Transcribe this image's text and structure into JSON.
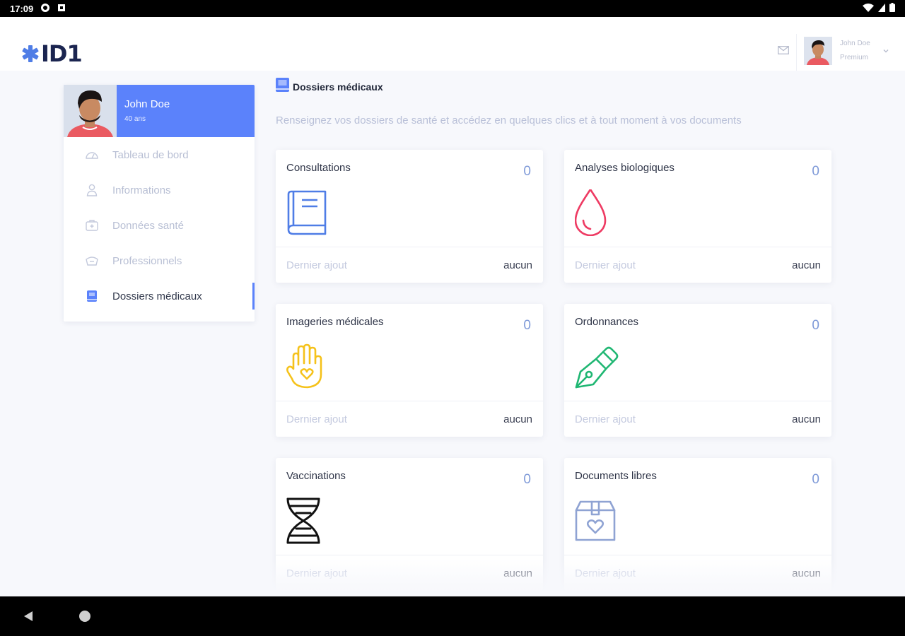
{
  "status_bar": {
    "time": "17:09"
  },
  "header": {
    "logo_text": "ID1",
    "user": {
      "name": "John Doe",
      "plan": "Premium"
    }
  },
  "profile": {
    "name": "John Doe",
    "age": "40 ans"
  },
  "sidebar": {
    "items": [
      {
        "label": "Tableau de bord",
        "icon": "dashboard-icon",
        "active": false
      },
      {
        "label": "Informations",
        "icon": "user-icon",
        "active": false
      },
      {
        "label": "Données santé",
        "icon": "health-icon",
        "active": false
      },
      {
        "label": "Professionnels",
        "icon": "professionals-icon",
        "active": false
      },
      {
        "label": "Dossiers médicaux",
        "icon": "folder-icon",
        "active": true
      }
    ]
  },
  "main": {
    "title": "Dossiers médicaux",
    "description": "Renseignez vos dossiers de santé et accédez en quelques clics et à tout moment à vos documents",
    "cards": [
      {
        "title": "Consultations",
        "count": "0",
        "icon": "book-icon",
        "color": "#4f7de6",
        "last_label": "Dernier ajout",
        "last_value": "aucun"
      },
      {
        "title": "Analyses biologiques",
        "count": "0",
        "icon": "blood-drop-icon",
        "color": "#ee3b63",
        "last_label": "Dernier ajout",
        "last_value": "aucun"
      },
      {
        "title": "Imageries médicales",
        "count": "0",
        "icon": "hand-heart-icon",
        "color": "#f5c21b",
        "last_label": "Dernier ajout",
        "last_value": "aucun"
      },
      {
        "title": "Ordonnances",
        "count": "0",
        "icon": "pen-nib-icon",
        "color": "#20b773",
        "last_label": "Dernier ajout",
        "last_value": "aucun"
      },
      {
        "title": "Vaccinations",
        "count": "0",
        "icon": "dna-icon",
        "color": "#111111",
        "last_label": "Dernier ajout",
        "last_value": "aucun"
      },
      {
        "title": "Documents libres",
        "count": "0",
        "icon": "box-heart-icon",
        "color": "#8fa3d3",
        "last_label": "Dernier ajout",
        "last_value": "aucun"
      }
    ]
  },
  "colors": {
    "accent": "#5b82fb"
  }
}
